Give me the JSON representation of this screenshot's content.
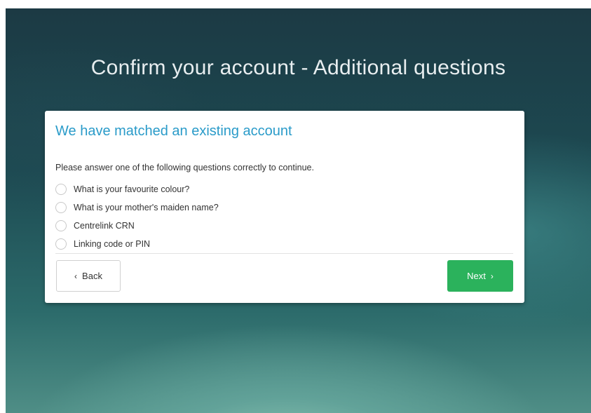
{
  "page": {
    "title": "Confirm your account - Additional questions"
  },
  "card": {
    "heading": "We have matched an existing account",
    "instruction": "Please answer one of the following questions correctly to continue.",
    "options": [
      {
        "label": "What is your favourite colour?",
        "selected": false
      },
      {
        "label": "What is your mother's maiden name?",
        "selected": false
      },
      {
        "label": "Centrelink CRN",
        "selected": false
      },
      {
        "label": "Linking code or PIN",
        "selected": false
      }
    ]
  },
  "buttons": {
    "back_label": "Back",
    "back_icon": "‹",
    "next_label": "Next",
    "next_icon": "›"
  },
  "colors": {
    "heading": "#2a9bc9",
    "next_button": "#2bb25c",
    "background_top": "#1c3a44",
    "background_bottom": "#4f8e86"
  }
}
